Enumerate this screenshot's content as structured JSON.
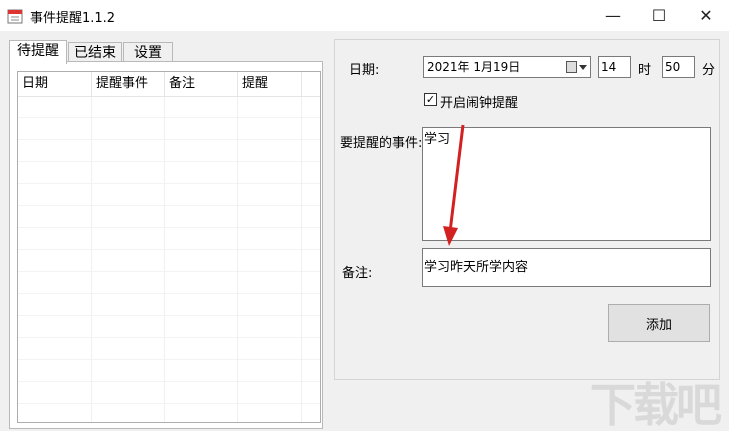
{
  "window": {
    "title": "事件提醒1.1.2",
    "controls": {
      "minimize": "—",
      "maximize": "☐",
      "close": "✕"
    }
  },
  "tabs": [
    {
      "label": "待提醒",
      "active": true
    },
    {
      "label": "已结束",
      "active": false
    },
    {
      "label": "设置",
      "active": false
    }
  ],
  "list": {
    "columns": [
      "日期",
      "提醒事件",
      "备注",
      "提醒"
    ],
    "rows": []
  },
  "form": {
    "date_label": "日期:",
    "date_value": "2021年  1月19日",
    "hour_value": "14",
    "hour_unit": "时",
    "minute_value": "50",
    "minute_unit": "分",
    "alarm_checkbox_label": "开启闹钟提醒",
    "alarm_checked": true,
    "event_label": "要提醒的事件:",
    "event_value": "学习",
    "note_label": "备注:",
    "note_value": "学习昨天所学内容",
    "add_button": "添加"
  },
  "colors": {
    "annotation_arrow": "#d32020"
  },
  "watermark": "下载吧"
}
